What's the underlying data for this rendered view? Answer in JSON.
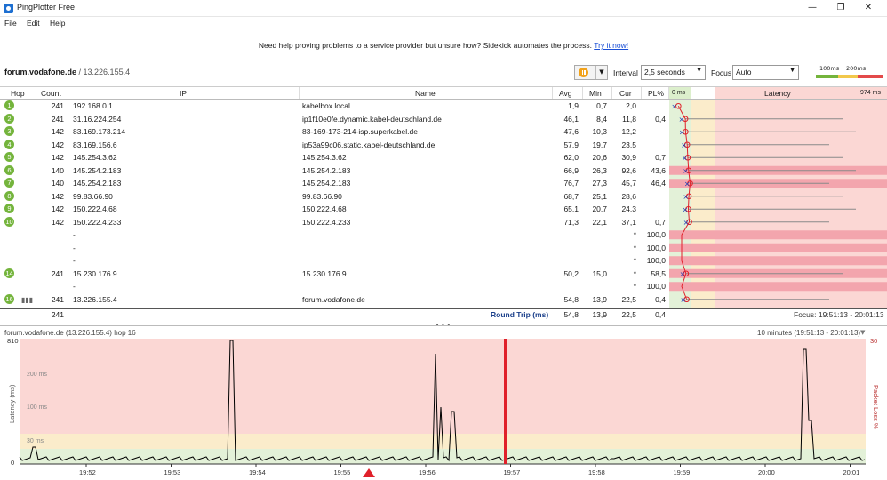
{
  "window": {
    "title": "PingPlotter Free",
    "minimize": "—",
    "restore": "❐",
    "close": "✕"
  },
  "menu": [
    "File",
    "Edit",
    "Help"
  ],
  "banner": {
    "text": "Need help proving problems to a service provider but unsure how? Sidekick automates the process.",
    "link": "Try it now!"
  },
  "target": {
    "name": "forum.vodafone.de",
    "separator": " / ",
    "ip": "13.226.155.4"
  },
  "controls": {
    "interval_label": "Interval",
    "interval_value": "2,5 seconds",
    "focus_label": "Focus",
    "focus_value": "Auto",
    "scale_100": "100ms",
    "scale_200": "200ms"
  },
  "columns": {
    "hop": "Hop",
    "count": "Count",
    "ip": "IP",
    "name": "Name",
    "avg": "Avg",
    "min": "Min",
    "cur": "Cur",
    "pl": "PL%",
    "latency_min": "0 ms",
    "latency": "Latency",
    "latency_max": "974 ms"
  },
  "hops": [
    {
      "hop": "1",
      "count": "241",
      "ip": "192.168.0.1",
      "name": "kabelbox.local",
      "avg": "1,9",
      "min": "0,7",
      "cur": "2,0",
      "pl": ""
    },
    {
      "hop": "2",
      "count": "241",
      "ip": "31.16.224.254",
      "name": "ip1f10e0fe.dynamic.kabel-deutschland.de",
      "avg": "46,1",
      "min": "8,4",
      "cur": "11,8",
      "pl": "0,4"
    },
    {
      "hop": "3",
      "count": "142",
      "ip": "83.169.173.214",
      "name": "83-169-173-214-isp.superkabel.de",
      "avg": "47,6",
      "min": "10,3",
      "cur": "12,2",
      "pl": ""
    },
    {
      "hop": "4",
      "count": "142",
      "ip": "83.169.156.6",
      "name": "ip53a99c06.static.kabel-deutschland.de",
      "avg": "57,9",
      "min": "19,7",
      "cur": "23,5",
      "pl": ""
    },
    {
      "hop": "5",
      "count": "142",
      "ip": "145.254.3.62",
      "name": "145.254.3.62",
      "avg": "62,0",
      "min": "20,6",
      "cur": "30,9",
      "pl": "0,7"
    },
    {
      "hop": "6",
      "count": "140",
      "ip": "145.254.2.183",
      "name": "145.254.2.183",
      "avg": "66,9",
      "min": "26,3",
      "cur": "92,6",
      "pl": "43,6"
    },
    {
      "hop": "7",
      "count": "140",
      "ip": "145.254.2.183",
      "name": "145.254.2.183",
      "avg": "76,7",
      "min": "27,3",
      "cur": "45,7",
      "pl": "46,4"
    },
    {
      "hop": "8",
      "count": "142",
      "ip": "99.83.66.90",
      "name": "99.83.66.90",
      "avg": "68,7",
      "min": "25,1",
      "cur": "28,6",
      "pl": ""
    },
    {
      "hop": "9",
      "count": "142",
      "ip": "150.222.4.68",
      "name": "150.222.4.68",
      "avg": "65,1",
      "min": "20,7",
      "cur": "24,3",
      "pl": ""
    },
    {
      "hop": "10",
      "count": "142",
      "ip": "150.222.4.233",
      "name": "150.222.4.233",
      "avg": "71,3",
      "min": "22,1",
      "cur": "37,1",
      "pl": "0,7"
    },
    {
      "hop": "",
      "count": "",
      "ip": "-",
      "name": "",
      "avg": "",
      "min": "",
      "cur": "*",
      "pl": "100,0"
    },
    {
      "hop": "",
      "count": "",
      "ip": "-",
      "name": "",
      "avg": "",
      "min": "",
      "cur": "*",
      "pl": "100,0"
    },
    {
      "hop": "",
      "count": "",
      "ip": "-",
      "name": "",
      "avg": "",
      "min": "",
      "cur": "*",
      "pl": "100,0"
    },
    {
      "hop": "14",
      "count": "241",
      "ip": "15.230.176.9",
      "name": "15.230.176.9",
      "avg": "50,2",
      "min": "15,0",
      "cur": "*",
      "pl": "58,5"
    },
    {
      "hop": "",
      "count": "",
      "ip": "-",
      "name": "",
      "avg": "",
      "min": "",
      "cur": "*",
      "pl": "100,0"
    },
    {
      "hop": "16",
      "count": "241",
      "ip": "13.226.155.4",
      "name": "forum.vodafone.de",
      "avg": "54,8",
      "min": "13,9",
      "cur": "22,5",
      "pl": "0,4"
    }
  ],
  "summary": {
    "count": "241",
    "label": "Round Trip (ms)",
    "avg": "54,8",
    "min": "13,9",
    "cur": "22,5",
    "pl": "0,4",
    "focus": "Focus: 19:51:13 - 20:01:13"
  },
  "graph": {
    "title": "forum.vodafone.de (13.226.155.4) hop 16",
    "range": "10 minutes (19:51:13 - 20:01:13)",
    "y_top": "810",
    "y_labels": [
      "200 ms",
      "100 ms",
      "30 ms",
      "0"
    ],
    "y_axis": "Latency (ms)",
    "right_axis": "Packet Loss %",
    "right_top": "30",
    "times": [
      "19:52",
      "19:53",
      "19:54",
      "19:55",
      "19:56",
      "19:57",
      "19:58",
      "19:59",
      "20:00",
      "20:01"
    ]
  },
  "colors": {
    "green": "#74b43c",
    "red_line": "#e0202a",
    "zone_green": "#e3f1d8",
    "zone_yellow": "#fbeccb",
    "zone_red": "#fbd7d4",
    "pl_bar": "#f3a5ad"
  }
}
